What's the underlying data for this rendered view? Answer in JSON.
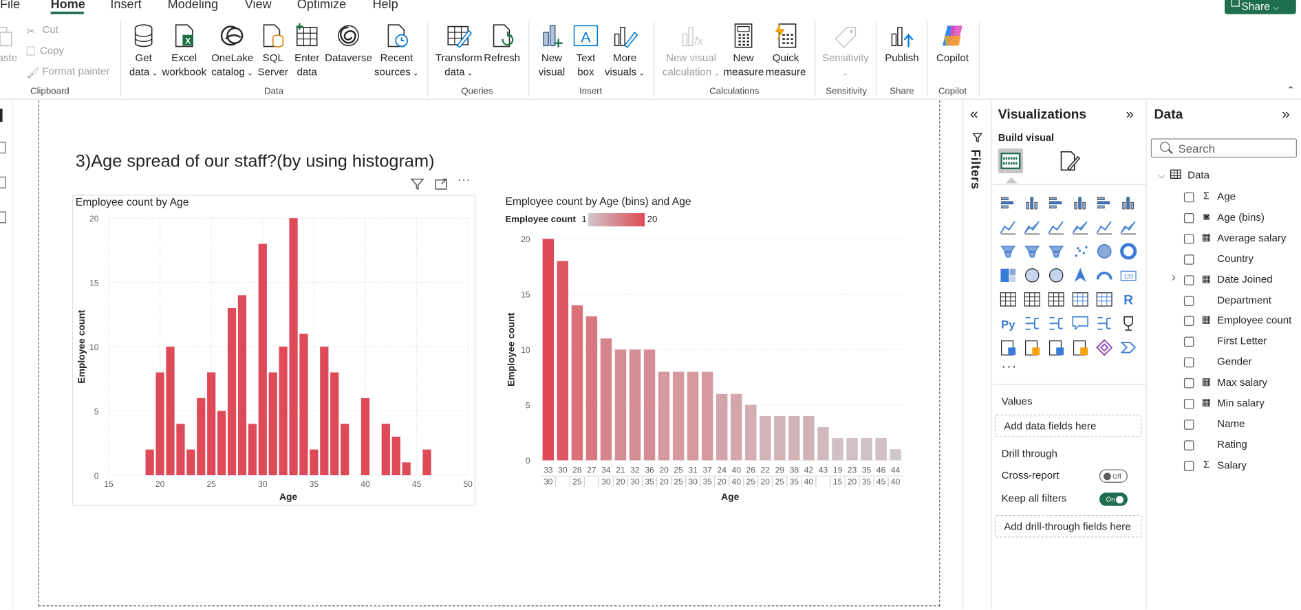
{
  "ribbon_tabs": [
    "File",
    "Home",
    "Insert",
    "Modeling",
    "View",
    "Optimize",
    "Help"
  ],
  "share_label": "Share",
  "clipboard": {
    "paste": "aste",
    "cut": "Cut",
    "copy": "Copy",
    "format_painter": "Format painter",
    "group_label": "Clipboard"
  },
  "data_group": {
    "get_data": [
      "Get",
      "data"
    ],
    "excel": [
      "Excel",
      "workbook"
    ],
    "onelake": [
      "OneLake",
      "catalog"
    ],
    "sql": [
      "SQL",
      "Server"
    ],
    "enter": [
      "Enter",
      "data"
    ],
    "dataverse": [
      "Dataverse",
      ""
    ],
    "recent": [
      "Recent",
      "sources"
    ],
    "group_label": "Data"
  },
  "queries_group": {
    "transform": [
      "Transform",
      "data"
    ],
    "refresh": [
      "Refresh",
      ""
    ],
    "group_label": "Queries"
  },
  "insert_group": {
    "new_visual": [
      "New",
      "visual"
    ],
    "text_box": [
      "Text",
      "box"
    ],
    "more_visuals": [
      "More",
      "visuals"
    ],
    "group_label": "Insert"
  },
  "calc_group": {
    "new_visual_calc": [
      "New visual",
      "calculation"
    ],
    "new_measure": [
      "New",
      "measure"
    ],
    "quick_measure": [
      "Quick",
      "measure"
    ],
    "group_label": "Calculations"
  },
  "sensitivity_group": {
    "label": "Sensitivity",
    "group_label": "Sensitivity"
  },
  "share_group": {
    "publish": "Publish",
    "group_label": "Share"
  },
  "copilot_group": {
    "copilot": "Copilot",
    "group_label": "Copilot"
  },
  "page_title": "3)Age spread of our staff?(by using histogram)",
  "visual1": {
    "title": "Employee count by Age",
    "xlabel": "Age",
    "ylabel": "Employee count"
  },
  "visual2": {
    "title": "Employee count by Age (bins) and Age",
    "legend_label": "Employee count",
    "legend_min": "1",
    "legend_max": "20",
    "xlabel": "Age",
    "ylabel": "Employee count"
  },
  "chart_data": [
    {
      "type": "bar",
      "title": "Employee count by Age",
      "xlabel": "Age",
      "ylabel": "Employee count",
      "xlim": [
        15,
        50
      ],
      "ylim": [
        0,
        20
      ],
      "xticks": [
        15,
        20,
        25,
        30,
        35,
        40,
        45,
        50
      ],
      "yticks": [
        0,
        5,
        10,
        15,
        20
      ],
      "grid": true,
      "color": "#de4a57",
      "x": [
        19,
        20,
        21,
        22,
        23,
        24,
        25,
        26,
        27,
        28,
        29,
        30,
        31,
        32,
        33,
        34,
        35,
        36,
        37,
        38,
        40,
        42,
        43,
        44,
        46
      ],
      "values": [
        2,
        8,
        10,
        4,
        2,
        6,
        8,
        5,
        13,
        14,
        4,
        18,
        8,
        10,
        20,
        11,
        2,
        10,
        8,
        4,
        6,
        4,
        3,
        1,
        2
      ]
    },
    {
      "type": "bar",
      "title": "Employee count by Age (bins) and Age",
      "xlabel": "Age",
      "ylabel": "Employee count",
      "ylim": [
        0,
        20
      ],
      "yticks": [
        0,
        5,
        10,
        15,
        20
      ],
      "grid": true,
      "legend": {
        "label": "Employee count",
        "min": 1,
        "max": 20,
        "gradient": [
          "#cfc7c9",
          "#de4a57"
        ]
      },
      "categories_age": [
        "33",
        "30",
        "28",
        "27",
        "34",
        "21",
        "32",
        "36",
        "20",
        "25",
        "31",
        "37",
        "24",
        "40",
        "26",
        "22",
        "29",
        "38",
        "42",
        "43",
        "19",
        "23",
        "35",
        "46",
        "44"
      ],
      "categories_bins": [
        "30",
        "",
        "25",
        "",
        "30",
        "20",
        "30",
        "35",
        "20",
        "25",
        "30",
        "35",
        "20",
        "40",
        "25",
        "20",
        "25",
        "35",
        "40",
        "",
        "15",
        "20",
        "35",
        "45",
        "40"
      ],
      "values": [
        20,
        18,
        14,
        13,
        11,
        10,
        10,
        10,
        8,
        8,
        8,
        8,
        6,
        6,
        5,
        4,
        4,
        4,
        4,
        3,
        2,
        2,
        2,
        2,
        1
      ]
    }
  ],
  "filters_label": "Filters",
  "viz_pane": {
    "title": "Visualizations",
    "build_visual": "Build visual",
    "values_label": "Values",
    "values_well": "Add data fields here",
    "drill_through": "Drill through",
    "cross_report": "Cross-report",
    "cross_report_state": "Off",
    "keep_filters": "Keep all filters",
    "keep_filters_state": "On",
    "drill_well": "Add drill-through fields here",
    "more": "···"
  },
  "data_pane": {
    "title": "Data",
    "search_placeholder": "Search",
    "table_name": "Data",
    "fields": [
      {
        "name": "Age",
        "type": "sigma"
      },
      {
        "name": "Age (bins)",
        "type": "bins"
      },
      {
        "name": "Average salary",
        "type": "calc"
      },
      {
        "name": "Country",
        "type": ""
      },
      {
        "name": "Date Joined",
        "type": "calendar",
        "expandable": true
      },
      {
        "name": "Department",
        "type": ""
      },
      {
        "name": "Employee count",
        "type": "calc"
      },
      {
        "name": "First Letter",
        "type": ""
      },
      {
        "name": "Gender",
        "type": ""
      },
      {
        "name": "Max salary",
        "type": "calc"
      },
      {
        "name": "Min salary",
        "type": "calc"
      },
      {
        "name": "Name",
        "type": ""
      },
      {
        "name": "Rating",
        "type": ""
      },
      {
        "name": "Salary",
        "type": "sigma"
      }
    ]
  },
  "colors": {
    "accent": "#1e6e4f",
    "bar": "#de4a57",
    "gradient_low": "#cfc7c9"
  }
}
